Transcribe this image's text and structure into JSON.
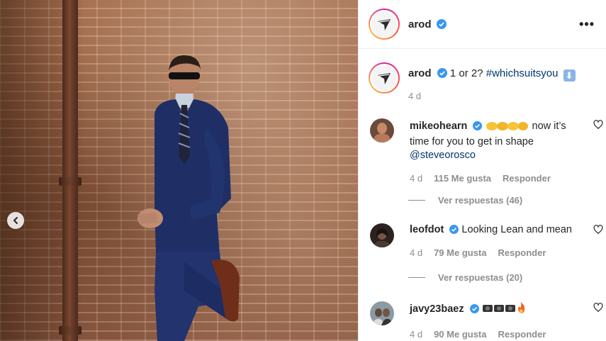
{
  "post": {
    "username": "arod",
    "caption_text": "1 or 2?",
    "caption_hashtag": "#whichsuitsyou",
    "caption_emoji": "⬇",
    "time": "4 d"
  },
  "comments": [
    {
      "username": "mikeohearn",
      "text_after_emoji": "now it’s time for you to get in shape",
      "mention": "@steveorosco",
      "time": "4 d",
      "likes": "115 Me gusta",
      "reply_label": "Responder",
      "view_replies": "Ver respuestas (46)"
    },
    {
      "username": "leofdot",
      "text": "Looking Lean and mean",
      "time": "4 d",
      "likes": "79 Me gusta",
      "reply_label": "Responder",
      "view_replies": "Ver respuestas (20)"
    },
    {
      "username": "javy23baez",
      "time": "4 d",
      "likes": "90 Me gusta",
      "reply_label": "Responder"
    }
  ],
  "icons": {
    "more": "more-options-icon",
    "verified": "verified-badge-icon",
    "heart": "heart-icon",
    "carousel_prev": "chevron-left-icon"
  },
  "colors": {
    "verified": "#3897f0",
    "link": "#00376b",
    "muted": "#8e8e8e"
  }
}
